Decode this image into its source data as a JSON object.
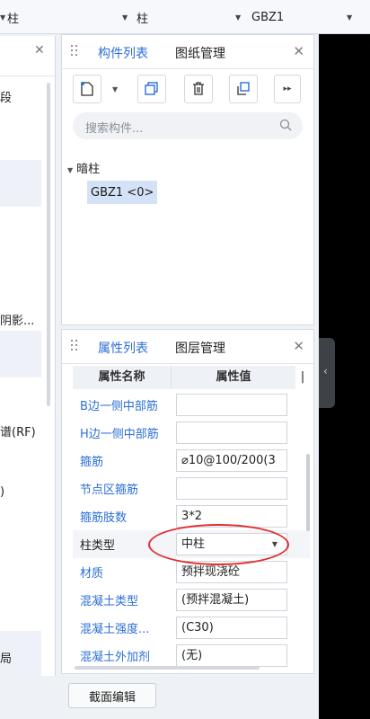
{
  "topbar": {
    "sel1": "柱",
    "sel2": "柱",
    "sel3": "GBZ1"
  },
  "left_panel": {
    "rows": [
      "段",
      "阴影...",
      "谱(RF)",
      ")",
      "局"
    ]
  },
  "component_panel": {
    "tab_active": "构件列表",
    "tab_inactive": "图纸管理",
    "search_placeholder": "搜索构件...",
    "tree_parent": "暗柱",
    "tree_child": "GBZ1 <0>"
  },
  "property_panel": {
    "tab_active": "属性列表",
    "tab_inactive": "图层管理",
    "header_name": "属性名称",
    "header_value": "属性值",
    "header_extra": "|",
    "rows": [
      {
        "name": "B边一侧中部筋",
        "value": ""
      },
      {
        "name": "H边一侧中部筋",
        "value": ""
      },
      {
        "name": "箍筋",
        "value": "⌀10@100/200(3"
      },
      {
        "name": "节点区箍筋",
        "value": ""
      },
      {
        "name": "箍筋肢数",
        "value": "3*2"
      },
      {
        "name": "柱类型",
        "value": "中柱"
      },
      {
        "name": "材质",
        "value": "预拌现浇砼"
      },
      {
        "name": "混凝土类型",
        "value": "(预拌混凝土)"
      },
      {
        "name": "混凝土强度...",
        "value": "(C30)"
      },
      {
        "name": "混凝土外加剂",
        "value": "(无)"
      }
    ]
  },
  "footer": {
    "section_edit_label": "截面编辑"
  },
  "colors": {
    "accent_blue": "#2c6fd6",
    "highlight": "#d3e2f7",
    "annotation_red": "#e22d2d"
  }
}
